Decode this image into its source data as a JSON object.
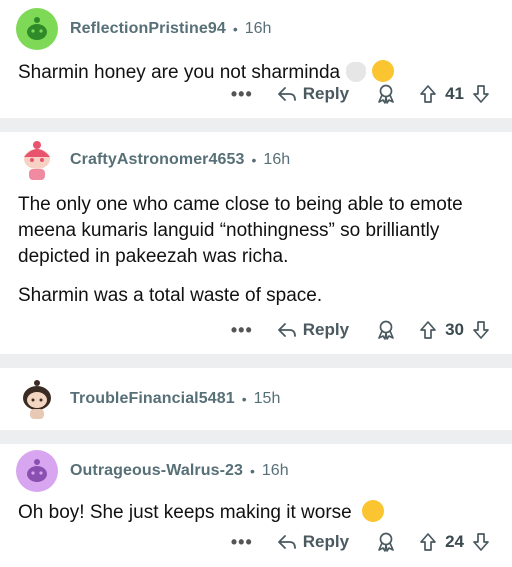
{
  "comments": [
    {
      "username": "ReflectionPristine94",
      "age": "16h",
      "paragraphs": [
        "Sharmin honey are you not sharminda"
      ],
      "emojis": [
        "skull-emoji",
        "crying-face-emoji"
      ],
      "reply_label": "Reply",
      "votes": "41",
      "avatar_color": "#7ed957"
    },
    {
      "username": "CraftyAstronomer4653",
      "age": "16h",
      "paragraphs": [
        "The only one who came close to being able to emote meena kumaris languid “nothingness” so brilliantly depicted in pakeezah was richa.",
        "Sharmin was a total waste of space."
      ],
      "reply_label": "Reply",
      "votes": "30",
      "avatar_color": "#f4a9b8"
    },
    {
      "username": "TroubleFinancial5481",
      "age": "15h",
      "avatar_color": "#f2d6c1"
    },
    {
      "username": "Outrageous-Walrus-23",
      "age": "16h",
      "paragraphs": [
        "Oh boy! She just keeps making it worse"
      ],
      "emojis": [
        "face-with-hand-over-mouth-emoji"
      ],
      "reply_label": "Reply",
      "votes": "24",
      "avatar_color": "#d8a6f0"
    }
  ],
  "more_label": "•••",
  "colors": {
    "page_bg": "#ffffff",
    "separator": "#eceef0",
    "meta": "#576f76"
  }
}
